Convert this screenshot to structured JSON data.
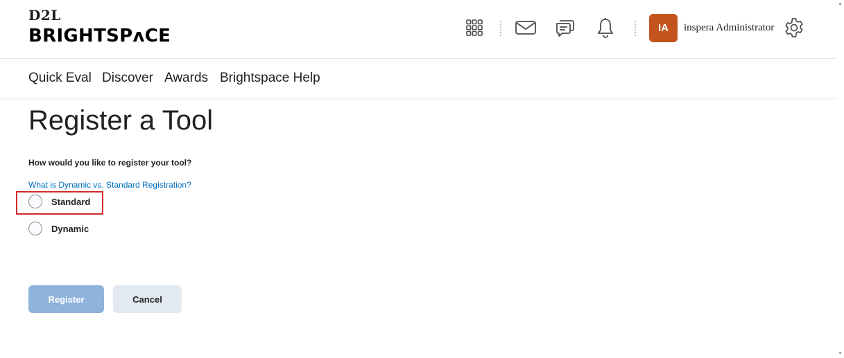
{
  "header": {
    "logo_top": "D2L",
    "logo_bottom": "BRIGHTSPʌCE",
    "avatar_initials": "IA",
    "username": "inspera Administrator",
    "icons": [
      "grid-icon",
      "mail-icon",
      "chat-icon",
      "bell-icon",
      "gear-icon"
    ]
  },
  "nav": {
    "items": [
      "Quick Eval",
      "Discover",
      "Awards",
      "Brightspace Help"
    ]
  },
  "page": {
    "title": "Register a Tool",
    "question": "How would you like to register your tool?",
    "help_link": "What is Dynamic vs. Standard Registration?",
    "options": [
      {
        "label": "Standard",
        "selected": false
      },
      {
        "label": "Dynamic",
        "selected": false
      }
    ],
    "register_label": "Register",
    "cancel_label": "Cancel"
  },
  "colors": {
    "avatar": "#c4531d",
    "link": "#006fbf",
    "primary_button": "#8eb3dc",
    "secondary_button": "#e3e9f1",
    "highlight": "#d02b2b"
  }
}
